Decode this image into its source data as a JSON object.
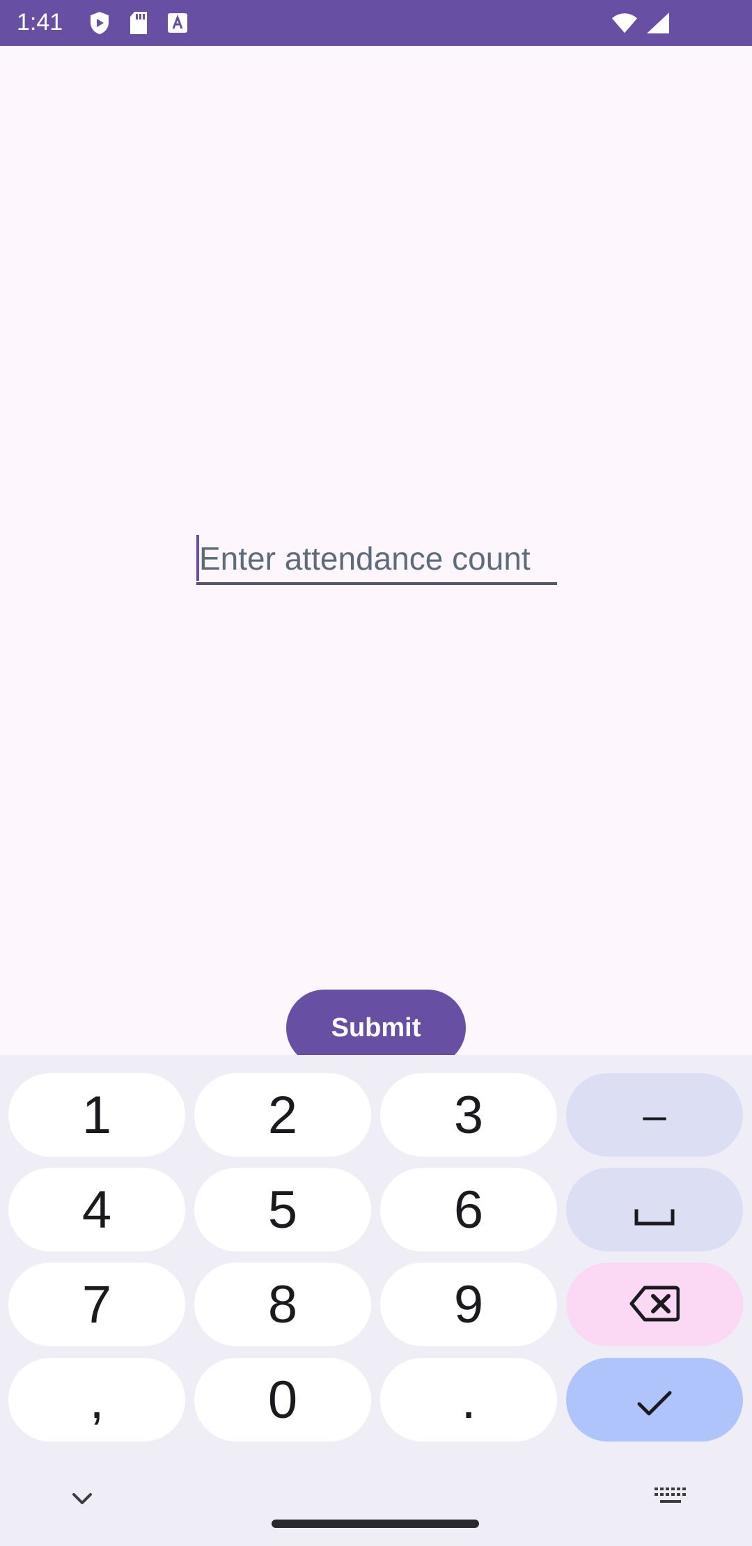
{
  "status_bar": {
    "time": "1:41",
    "background": "#6750a4",
    "left_icons": [
      "shield-icon",
      "sd-card-icon",
      "text-a-icon"
    ],
    "right_icons": [
      "wifi-icon",
      "cell-signal-icon"
    ]
  },
  "form": {
    "attendance_placeholder": "Enter attendance count",
    "attendance_value": "",
    "submit_label": "Submit",
    "accent": "#6750a4"
  },
  "keyboard": {
    "rows": [
      [
        "1",
        "2",
        "3",
        "–"
      ],
      [
        "4",
        "5",
        "6",
        "space"
      ],
      [
        "7",
        "8",
        "9",
        "backspace"
      ],
      [
        ",",
        "0",
        ".",
        "done"
      ]
    ],
    "keys": {
      "k1": "1",
      "k2": "2",
      "k3": "3",
      "k4": "4",
      "k5": "5",
      "k6": "6",
      "k7": "7",
      "k8": "8",
      "k9": "9",
      "comma": ",",
      "k0": "0",
      "period": ".",
      "dash": "–"
    },
    "colors": {
      "background": "#efedf5",
      "digit_key": "#ffffff",
      "function_key": "#dcdff4",
      "backspace_key": "#fbd8f3",
      "done_key": "#afc4fb"
    }
  }
}
